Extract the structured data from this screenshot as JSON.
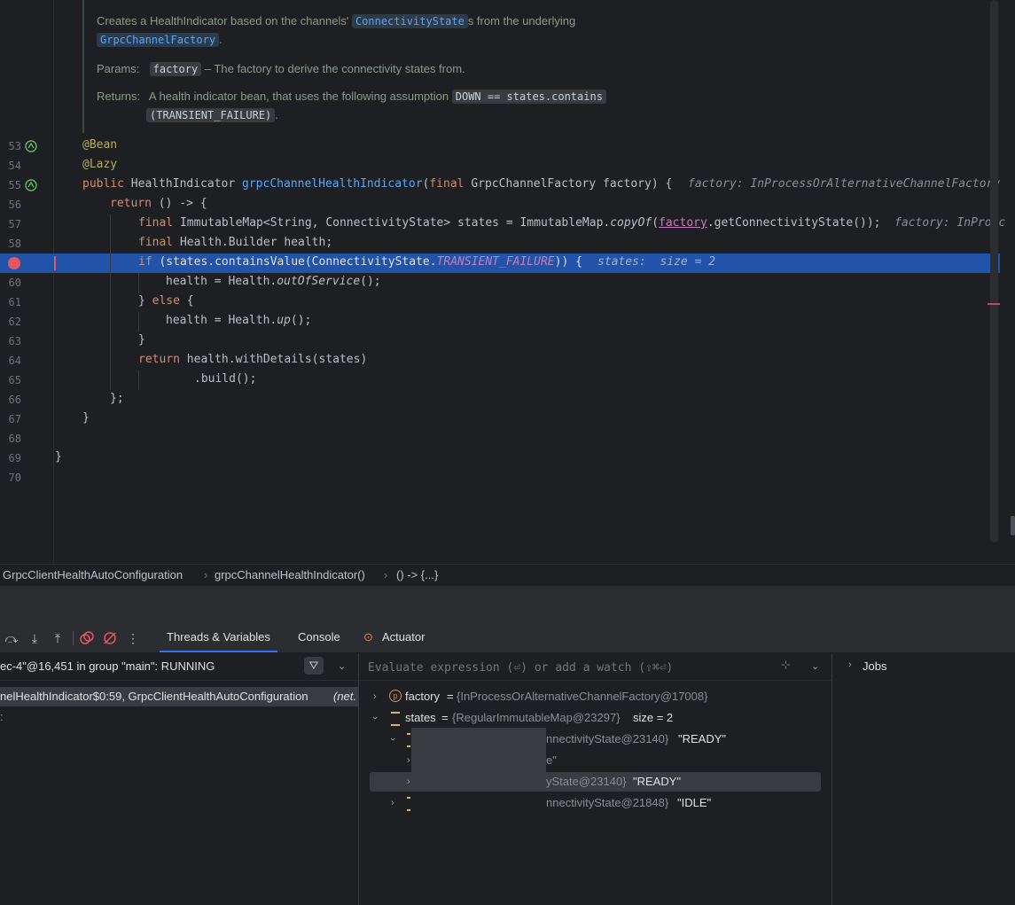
{
  "doc": {
    "line1_pre": "Creates a HealthIndicator based on the channels'",
    "line1_link": "ConnectivityState",
    "line1_post": "s from the underlying",
    "line2_link": "GrpcChannelFactory",
    "line2_post": ".",
    "params_label": "Params:",
    "params_code": "factory",
    "params_text": "– The factory to derive the connectivity states from.",
    "returns_label": "Returns:",
    "returns_text": "A health indicator bean, that uses the following assumption",
    "returns_code1": "DOWN == states.contains",
    "returns_code2": "(TRANSIENT_FAILURE)",
    "returns_post": "."
  },
  "code_lines": [
    {
      "n": "53",
      "t": "@Bean"
    },
    {
      "n": "54",
      "t": "@Lazy"
    },
    {
      "n": "55",
      "t": "public HealthIndicator grpcChannelHealthIndicator(final GrpcChannelFactory factory) {"
    },
    {
      "n": "56",
      "t": "return () -> {"
    },
    {
      "n": "57",
      "t": "final ImmutableMap<String, ConnectivityState> states = ImmutableMap.copyOf(factory.getConnectivityState());"
    },
    {
      "n": "58",
      "t": "final Health.Builder health;"
    },
    {
      "n": "59",
      "t": "if (states.containsValue(ConnectivityState.TRANSIENT_FAILURE)) {"
    },
    {
      "n": "60",
      "t": "health = Health.outOfService();"
    },
    {
      "n": "61",
      "t": "} else {"
    },
    {
      "n": "62",
      "t": "health = Health.up();"
    },
    {
      "n": "63",
      "t": "}"
    },
    {
      "n": "64",
      "t": "return health.withDetails(states)"
    },
    {
      "n": "65",
      "t": ".build();"
    },
    {
      "n": "66",
      "t": "};"
    },
    {
      "n": "67",
      "t": "}"
    },
    {
      "n": "68",
      "t": ""
    },
    {
      "n": "69",
      "t": "}"
    },
    {
      "n": "70",
      "t": ""
    }
  ],
  "hints": {
    "line55": "factory: InProcessOrAlternativeChannelFactory",
    "line57": "factory: InProcc",
    "line59": "states:  size = 2"
  },
  "breadcrumb": [
    "GrpcClientHealthAutoConfiguration",
    "grpcChannelHealthIndicator()",
    "() -> {...}"
  ],
  "debug": {
    "tabs": [
      "Threads & Variables",
      "Console",
      "Actuator"
    ],
    "thread_status": "ec-4\"@16,451 in group \"main\": RUNNING",
    "frame": "nelHealthIndicator$0:59, GrpcClientHealthAutoConfiguration",
    "frame_pkg": "(net.",
    "watch_placeholder": "Evaluate expression (⏎) or add a watch (⇧⌘⏎)",
    "jobs_label": "Jobs",
    "vars": {
      "factory_name": "factory",
      "factory_value": "{InProcessOrAlternativeChannelFactory@17008}",
      "states_name": "states",
      "states_value": "{RegularImmutableMap@23297}",
      "states_size": "size = 2",
      "entry1": "nnectivityState@23140}",
      "entry1_val": "\"READY\"",
      "entry1_child": "e\"",
      "entry2": "yState@23140}",
      "entry2_val": "\"READY\"",
      "entry3": "nnectivityState@21848}",
      "entry3_val": "\"IDLE\""
    }
  },
  "colors": {
    "accent": "#3574f0",
    "current_line": "#2154a8",
    "breakpoint": "#e55765"
  }
}
